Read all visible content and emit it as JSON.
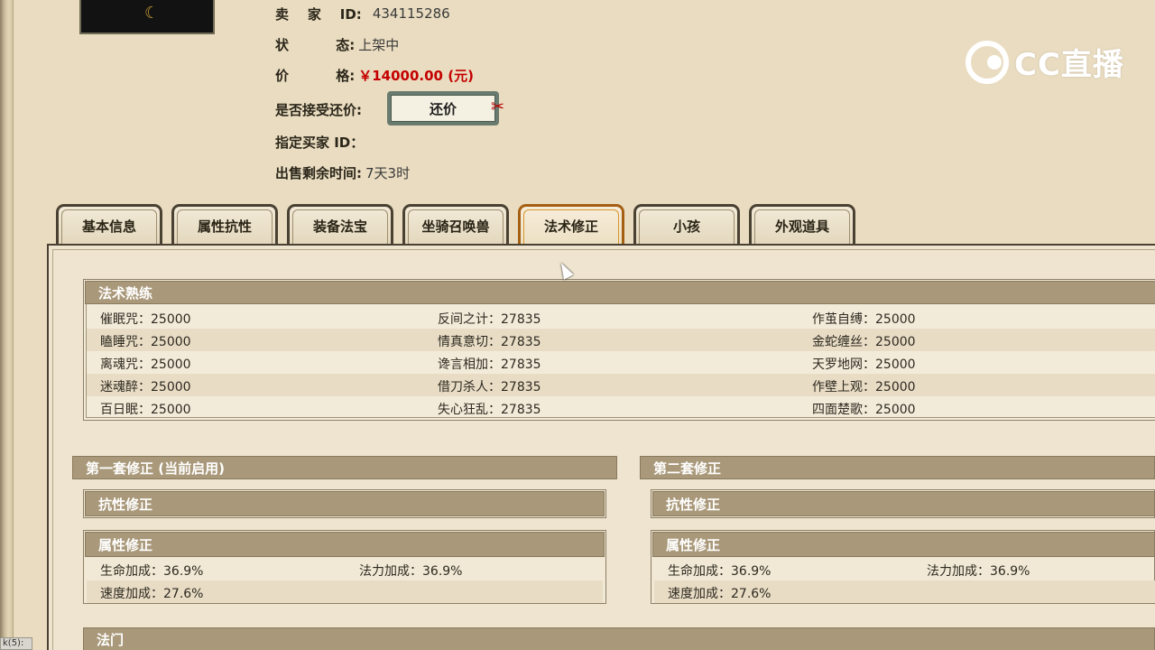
{
  "seller": {
    "label": "卖    家    ID:",
    "value": "434115286"
  },
  "status": {
    "label": "状          态:",
    "value": "上架中"
  },
  "price": {
    "label": "价          格:",
    "value": "￥14000.00 (元)"
  },
  "counter_offer": {
    "label": "是否接受还价:",
    "button": "还价"
  },
  "buyer": {
    "label": "指定买家 ID：",
    "value": ""
  },
  "remaining": {
    "label": "出售剩余时间:",
    "value": "7天3时"
  },
  "logo": {
    "text": "CC直播"
  },
  "tabs": [
    {
      "label": "基本信息",
      "active": false
    },
    {
      "label": "属性抗性",
      "active": false
    },
    {
      "label": "装备法宝",
      "active": false
    },
    {
      "label": "坐骑召唤兽",
      "active": false
    },
    {
      "label": "法术修正",
      "active": true
    },
    {
      "label": "小孩",
      "active": false
    },
    {
      "label": "外观道具",
      "active": false
    }
  ],
  "skills": {
    "title": "法术熟练",
    "rows": [
      [
        "催眠咒：25000",
        "反间之计：27835",
        "作茧自缚：25000"
      ],
      [
        "瞌睡咒：25000",
        "情真意切：27835",
        "金蛇缠丝：25000"
      ],
      [
        "离魂咒：25000",
        "谗言相加：27835",
        "天罗地网：25000"
      ],
      [
        "迷魂醉：25000",
        "借刀杀人：27835",
        "作壁上观：25000"
      ],
      [
        "百日眠：25000",
        "失心狂乱：27835",
        "四面楚歌：25000"
      ]
    ]
  },
  "set1": {
    "title": "第一套修正 (当前启用)",
    "resist": "抗性修正",
    "attr": "属性修正",
    "attr_rows": [
      [
        "生命加成：36.9%",
        "法力加成：36.9%"
      ],
      [
        "速度加成：27.6%",
        ""
      ]
    ]
  },
  "set2": {
    "title": "第二套修正",
    "resist": "抗性修正",
    "attr": "属性修正",
    "attr_rows": [
      [
        "生命加成：36.9%",
        "法力加成：36.9%"
      ],
      [
        "速度加成：27.6%",
        ""
      ]
    ]
  },
  "school": {
    "title": "法门"
  },
  "corner_tip": "k(5):"
}
